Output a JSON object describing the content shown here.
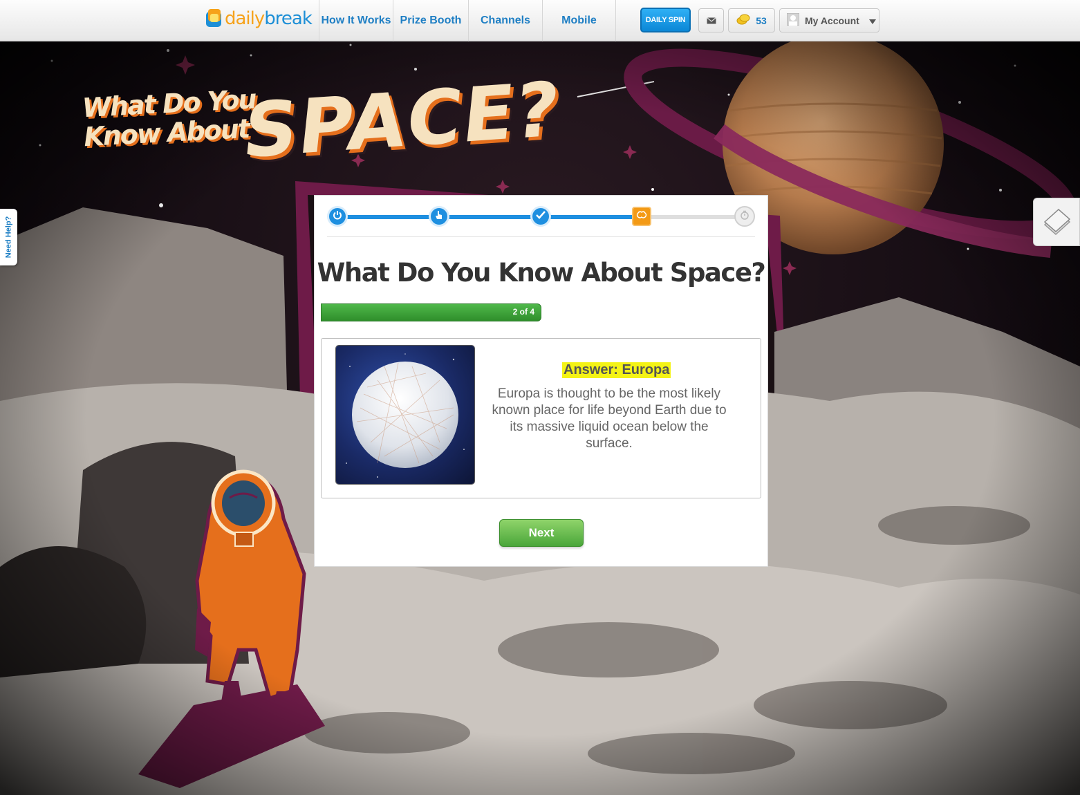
{
  "header": {
    "logo_part1": "daily",
    "logo_part2": "break",
    "nav": [
      {
        "label": "How It Works"
      },
      {
        "label": "Prize Booth"
      },
      {
        "label": "Channels"
      },
      {
        "label": "Mobile"
      }
    ],
    "daily_spin_label": "DAILY SPIN",
    "coins": "53",
    "account_label": "My Account"
  },
  "scene": {
    "headline_line1": "What Do You",
    "headline_line2": "Know About",
    "headline_big": "SPACE?"
  },
  "quiz": {
    "title": "What Do You Know About Space?",
    "progress_label": "2 of 4",
    "progress_fraction": 0.5,
    "answer_label": "Answer: Europa",
    "answer_text": "Europa is thought to be the most likely known place for life beyond Earth due to its massive liquid ocean below the surface.",
    "next_label": "Next"
  },
  "side": {
    "help_label": "Need Help?"
  },
  "colors": {
    "brand_blue": "#1e8fe0",
    "brand_orange": "#f39a16",
    "progress_green": "#3fa33a",
    "highlight_yellow": "#f4f316"
  },
  "icons": [
    "power-icon",
    "hand-pointer-icon",
    "checkmark-icon",
    "brain-icon",
    "stopwatch-icon",
    "mail-icon",
    "coins-icon",
    "user-avatar-icon",
    "dropdown-arrow-icon",
    "notes-icon"
  ]
}
